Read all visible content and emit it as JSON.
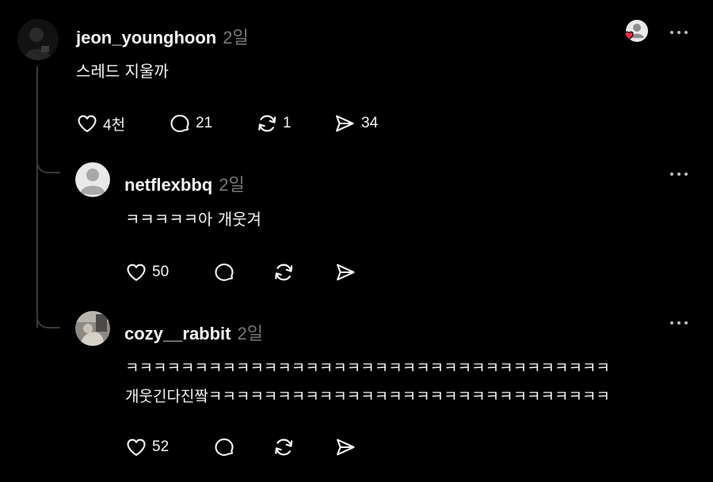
{
  "colors": {
    "background": "#000000",
    "text": "#f3f5f7",
    "muted": "#777777",
    "heart_badge": "#ff3040"
  },
  "post": {
    "username": "jeon_younghoon",
    "time": "2일",
    "text": "스레드 지울까",
    "likes": "4천",
    "replies": "21",
    "reposts": "1",
    "shares": "34",
    "liked_by_indicator_icon": "avatar-with-heart-icon"
  },
  "comments": [
    {
      "username": "netflexbbq",
      "time": "2일",
      "lines": [
        "ㅋㅋㅋㅋㅋ아 개웃겨"
      ],
      "likes": "50"
    },
    {
      "username": "cozy__rabbit",
      "time": "2일",
      "lines": [
        "ㅋㅋㅋㅋㅋㅋㅋㅋㅋㅋㅋㅋㅋㅋㅋㅋㅋㅋㅋㅋㅋㅋㅋㅋㅋㅋㅋㅋㅋㅋㅋㅋㅋㅋㅋ",
        "개웃긴다진짴ㅋㅋㅋㅋㅋㅋㅋㅋㅋㅋㅋㅋㅋㅋㅋㅋㅋㅋㅋㅋㅋㅋㅋㅋㅋㅋㅋㅋㅋ"
      ],
      "likes": "52"
    }
  ]
}
